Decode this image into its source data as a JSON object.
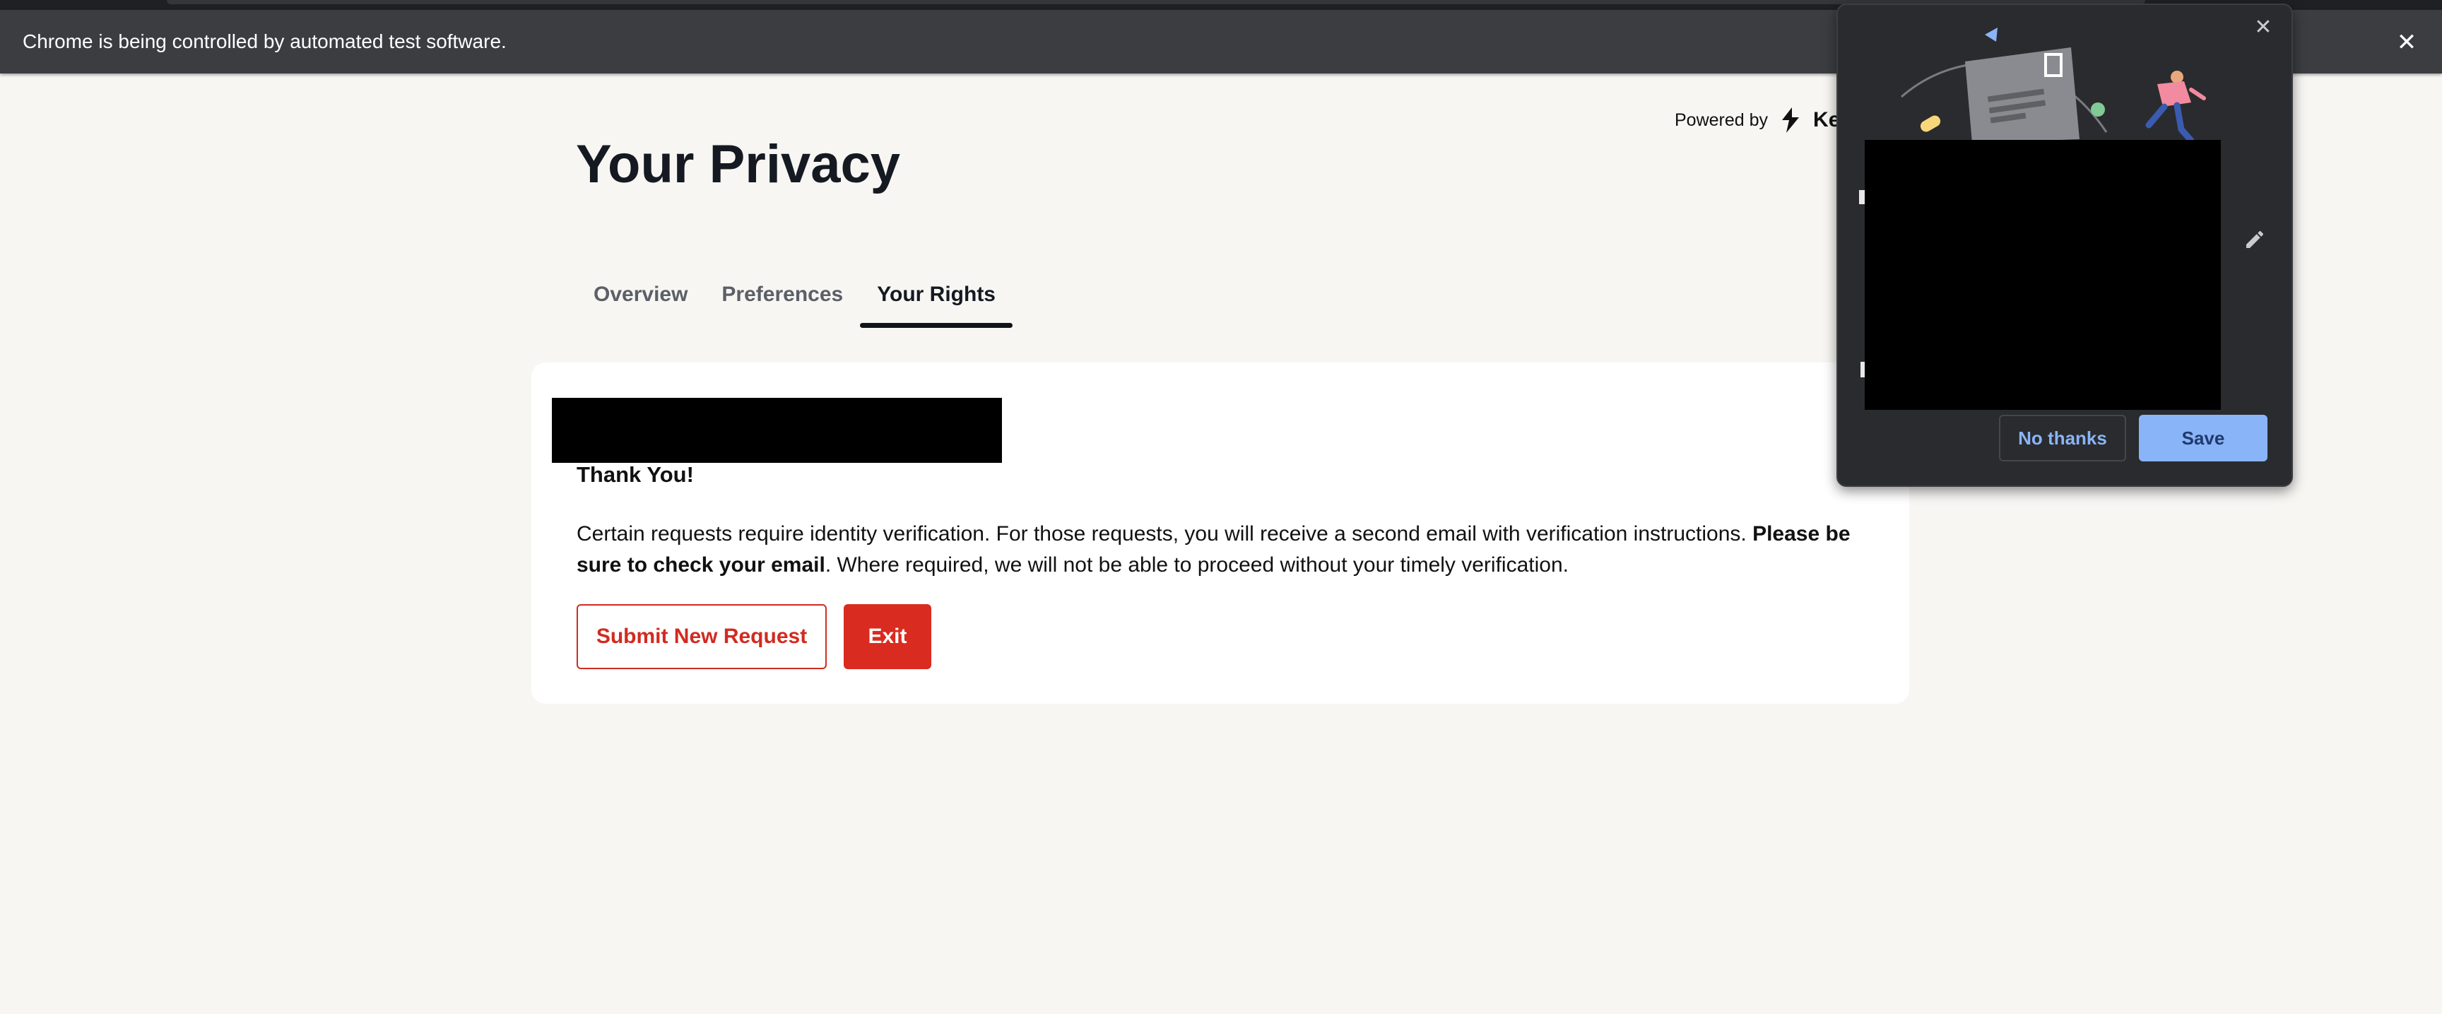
{
  "browser": {
    "infobar_text": "Chrome is being controlled by automated test software.",
    "infobar_close_icon": "close-icon"
  },
  "header": {
    "powered_by": "Powered by",
    "brand_name": "Ke",
    "brand_logo_icon": "brand-logo-icon",
    "title": "Your Privacy"
  },
  "tabs": [
    {
      "label": "Overview",
      "active": false
    },
    {
      "label": "Preferences",
      "active": false
    },
    {
      "label": "Your Rights",
      "active": true
    }
  ],
  "confirmation": {
    "heading": "Thank You!",
    "message_before_bold": "Certain requests require identity verification. For those requests, you will receive a second email with verification instructions. ",
    "message_bold": "Please be sure to check your email",
    "message_after_bold": ". Where required, we will not be able to proceed without your timely verification.",
    "submit_new_label": "Submit New Request",
    "exit_label": "Exit"
  },
  "popup": {
    "close_icon": "close-icon",
    "edit_icon": "pencil-icon",
    "no_thanks_label": "No thanks",
    "save_label": "Save"
  },
  "colors": {
    "page_bg": "#f7f6f3",
    "accent_red": "#d92b1f",
    "popup_bg": "#2a2b2e",
    "popup_accent": "#8ab4f8"
  }
}
